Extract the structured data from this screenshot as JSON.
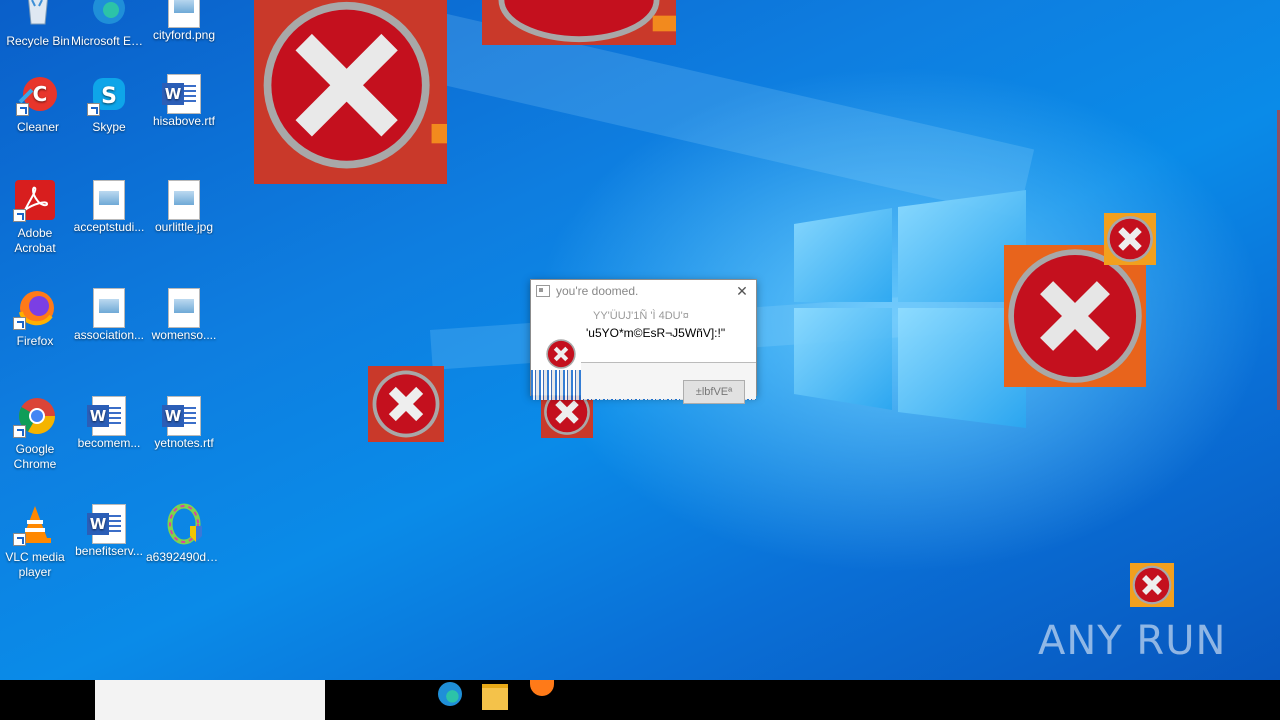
{
  "desktop": {
    "icons": [
      {
        "label": "Recycle Bin",
        "icon": "recycle-bin-icon"
      },
      {
        "label": "Microsoft Edge",
        "icon": "edge-icon"
      },
      {
        "label": "cityford.png",
        "icon": "image-file-icon"
      },
      {
        "label": "Cleaner",
        "icon": "ccleaner-icon"
      },
      {
        "label": "Skype",
        "icon": "skype-icon"
      },
      {
        "label": "hisabove.rtf",
        "icon": "word-document-icon"
      },
      {
        "label": "Adobe Acrobat",
        "icon": "acrobat-icon"
      },
      {
        "label": "acceptstudi...",
        "icon": "image-file-icon"
      },
      {
        "label": "ourlittle.jpg",
        "icon": "image-file-icon"
      },
      {
        "label": "Firefox",
        "icon": "firefox-icon"
      },
      {
        "label": "association...",
        "icon": "image-file-icon"
      },
      {
        "label": "womenso....",
        "icon": "image-file-icon"
      },
      {
        "label": "Google Chrome",
        "icon": "chrome-icon"
      },
      {
        "label": "becomem...",
        "icon": "word-document-icon"
      },
      {
        "label": "yetnotes.rtf",
        "icon": "word-document-icon"
      },
      {
        "label": "VLC media player",
        "icon": "vlc-icon"
      },
      {
        "label": "benefitserv...",
        "icon": "word-document-icon"
      },
      {
        "label": "a6392490d3...",
        "icon": "installer-icon"
      }
    ]
  },
  "dialog": {
    "title": "you're doomed.",
    "close_glyph": "✕",
    "message": "'u5YO*m©EsR¬J5WñV]:!\"",
    "message_ghost": "YY'ÜUJ'1Ñ  'Ì  4DU'¤",
    "button_label": "±lbfVEª"
  },
  "watermark": {
    "text": "ANY RUN"
  },
  "colors": {
    "desktop_blue": "#0a78d7",
    "error_red": "#c8102e",
    "taskbar": "#000000"
  }
}
